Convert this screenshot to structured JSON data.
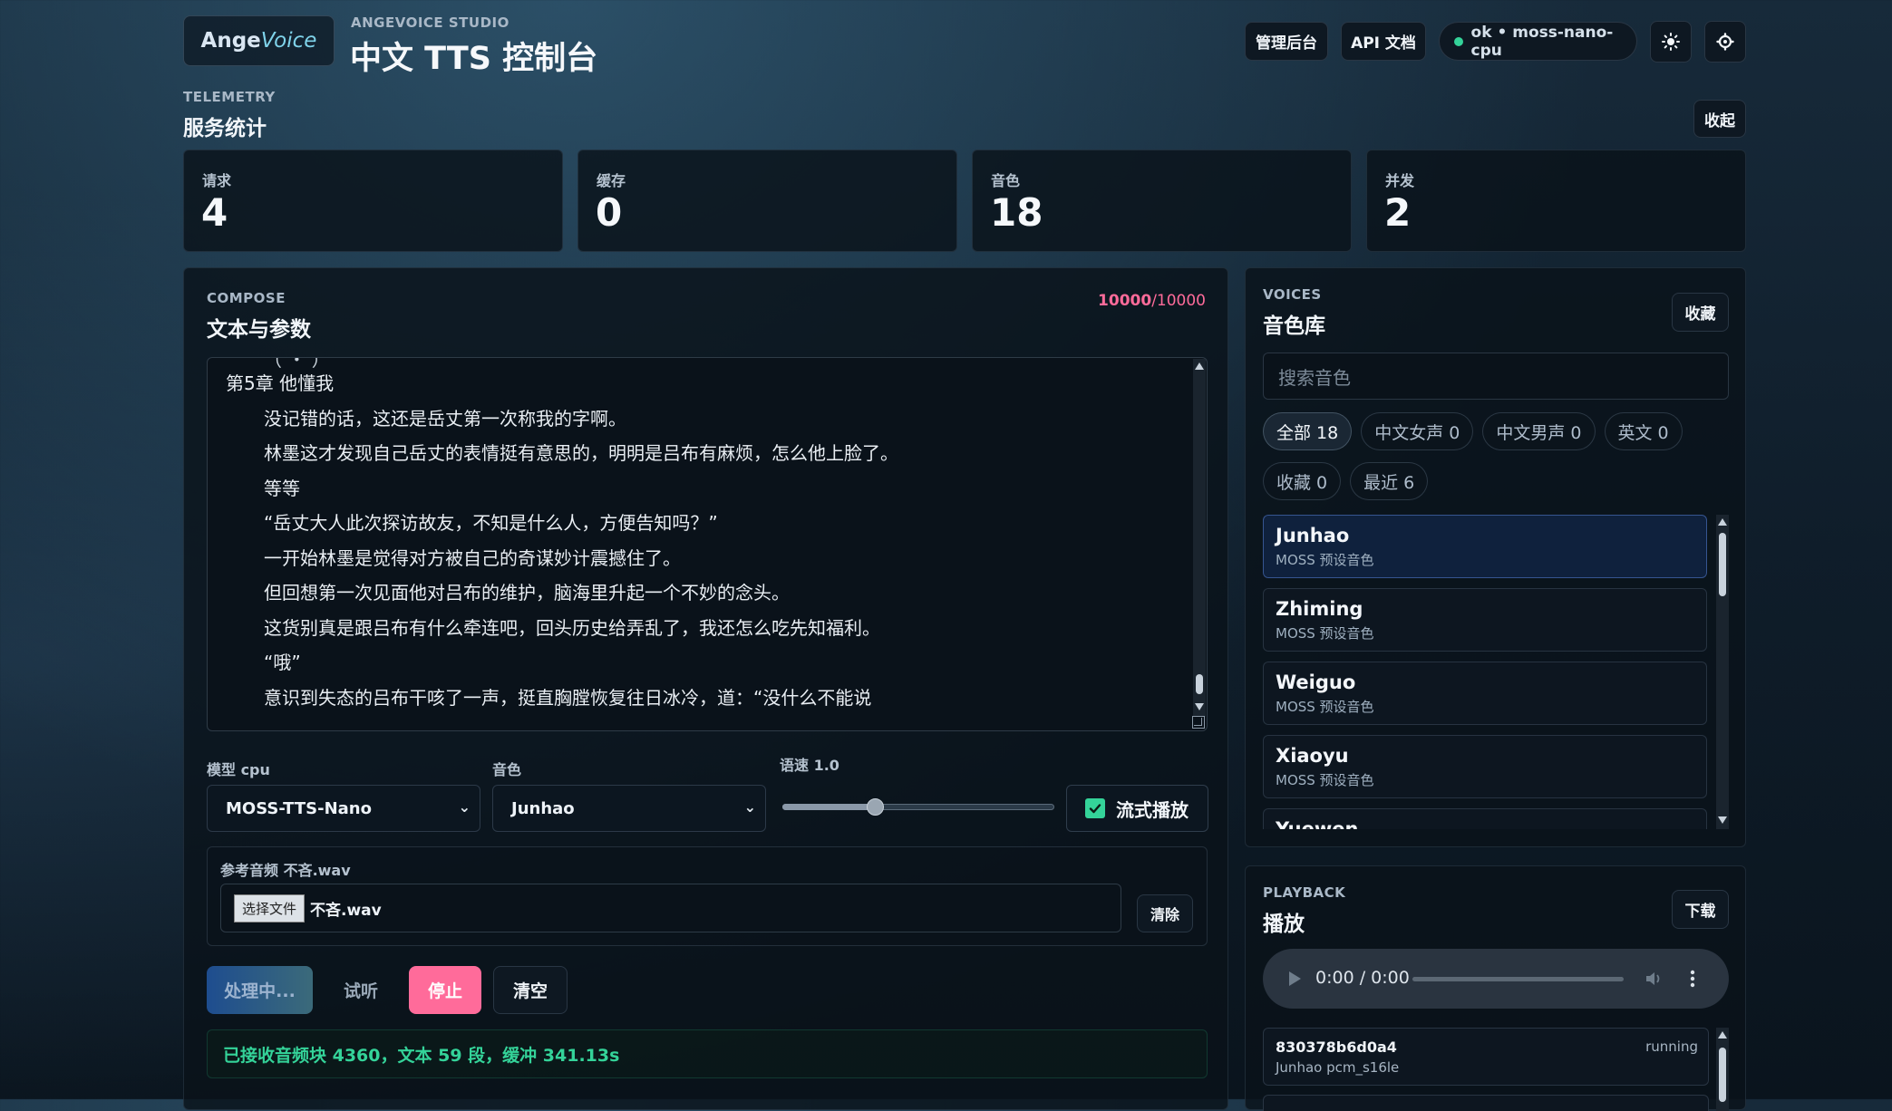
{
  "header": {
    "logo_plain": "Ange",
    "logo_accent": "Voice",
    "studio": "ANGEVOICE STUDIO",
    "title": "中文 TTS 控制台",
    "admin_btn": "管理后台",
    "api_btn": "API 文档",
    "status_text": "ok • moss-nano-cpu",
    "theme_icon": "sun-icon",
    "settings_icon": "gear-icon"
  },
  "telemetry": {
    "kicker": "TELEMETRY",
    "title": "服务统计",
    "collapse_btn": "收起",
    "stats": [
      {
        "label": "请求",
        "value": "4"
      },
      {
        "label": "缓存",
        "value": "0"
      },
      {
        "label": "音色",
        "value": "18"
      },
      {
        "label": "并发",
        "value": "2"
      }
    ]
  },
  "compose": {
    "kicker": "COMPOSE",
    "title": "文本与参数",
    "count_used": "10000",
    "count_max": "/10000",
    "text_lines": [
      "第5章 他懂我",
      "没记错的话，这还是岳丈第一次称我的字啊。",
      "林墨这才发现自己岳丈的表情挺有意思的，明明是吕布有麻烦，怎么他上脸了。",
      "等等",
      "“岳丈大人此次探访故友，不知是什么人，方便告知吗？”",
      "一开始林墨是觉得对方被自己的奇谋妙计震撼住了。",
      "但回想第一次见面他对吕布的维护，脑海里升起一个不妙的念头。",
      "这货别真是跟吕布有什么牵连吧，回头历史给弄乱了，我还怎么吃先知福利。",
      "“哦”",
      "意识到失态的吕布干咳了一声，挺直胸膛恢复往日冰冷，道：“没什么不能说"
    ],
    "model_label": "模型 cpu",
    "model_value": "MOSS-TTS-Nano",
    "voice_label": "音色",
    "voice_value": "Junhao",
    "speed_label": "语速 1.0",
    "speed_fraction": 0.34,
    "stream_label": "流式播放",
    "stream_checked": true,
    "ref_label": "参考音频 不吝.wav",
    "file_btn": "选择文件",
    "file_name": "不吝.wav",
    "clear_ref_btn": "清除",
    "processing_btn": "处理中...",
    "preview_btn": "试听",
    "stop_btn": "停止",
    "clear_btn": "清空",
    "status_msg": "已接收音频块 4360，文本 59 段，缓冲 341.13s"
  },
  "voices": {
    "kicker": "VOICES",
    "title": "音色库",
    "fav_btn": "收藏",
    "search_placeholder": "搜索音色",
    "chips": [
      "全部 18",
      "中文女声 0",
      "中文男声 0",
      "英文 0",
      "收藏 0",
      "最近 6"
    ],
    "items": [
      {
        "name": "Junhao",
        "sub": "MOSS 预设音色"
      },
      {
        "name": "Zhiming",
        "sub": "MOSS 预设音色"
      },
      {
        "name": "Weiguo",
        "sub": "MOSS 预设音色"
      },
      {
        "name": "Xiaoyu",
        "sub": "MOSS 预设音色"
      },
      {
        "name": "Yuewen",
        "sub": ""
      }
    ]
  },
  "playback": {
    "kicker": "PLAYBACK",
    "title": "播放",
    "download_btn": "下载",
    "time": "0:00 / 0:00",
    "job_id": "830378b6d0a4",
    "job_status": "running",
    "job_meta": "Junhao pcm_s16le"
  },
  "colors": {
    "accent_pink": "#ff6b9a",
    "ok_green": "#34d399",
    "status_green": "#4ade80"
  }
}
